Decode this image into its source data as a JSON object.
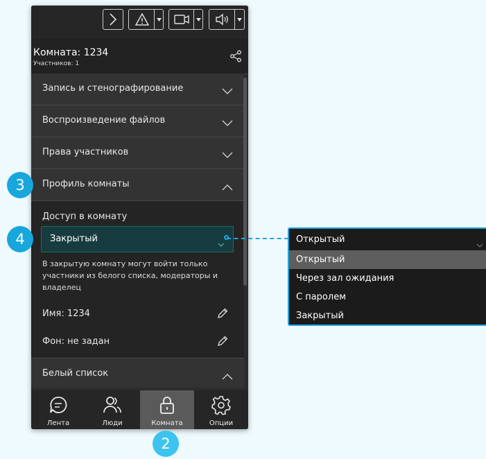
{
  "header": {
    "room_title": "Комната: 1234",
    "participants": "Участников: 1"
  },
  "toolbar_icons": [
    "chevron-right-icon",
    "warning-icon",
    "camera-icon",
    "speaker-icon",
    "share-icon"
  ],
  "sections": [
    {
      "label": "Запись и стенографирование"
    },
    {
      "label": "Воспроизведение файлов"
    },
    {
      "label": "Права участников"
    },
    {
      "label": "Профиль комнаты"
    }
  ],
  "profile": {
    "access_label": "Доступ в комнату",
    "access_value": "Закрытый",
    "description": "В закрытую комнату могут войти только участники из белого списка, модераторы и владелец",
    "name": "Имя: 1234",
    "background": "Фон: не задан"
  },
  "white_list": {
    "label": "Белый список"
  },
  "nav": {
    "items": [
      {
        "label": "Лента"
      },
      {
        "label": "Люди"
      },
      {
        "label": "Комната"
      },
      {
        "label": "Опции"
      }
    ]
  },
  "callouts": {
    "c2": "2",
    "c3": "3",
    "c4": "4"
  },
  "dropdown": {
    "selected": "Открытый",
    "options": [
      {
        "label": "Открытый"
      },
      {
        "label": "Через зал ожидания"
      },
      {
        "label": "С паролем"
      },
      {
        "label": "Закрытый"
      }
    ]
  },
  "colors": {
    "accent": "#22a4e0",
    "badge": "#18a7dd",
    "panel": "#2b2b2b"
  }
}
